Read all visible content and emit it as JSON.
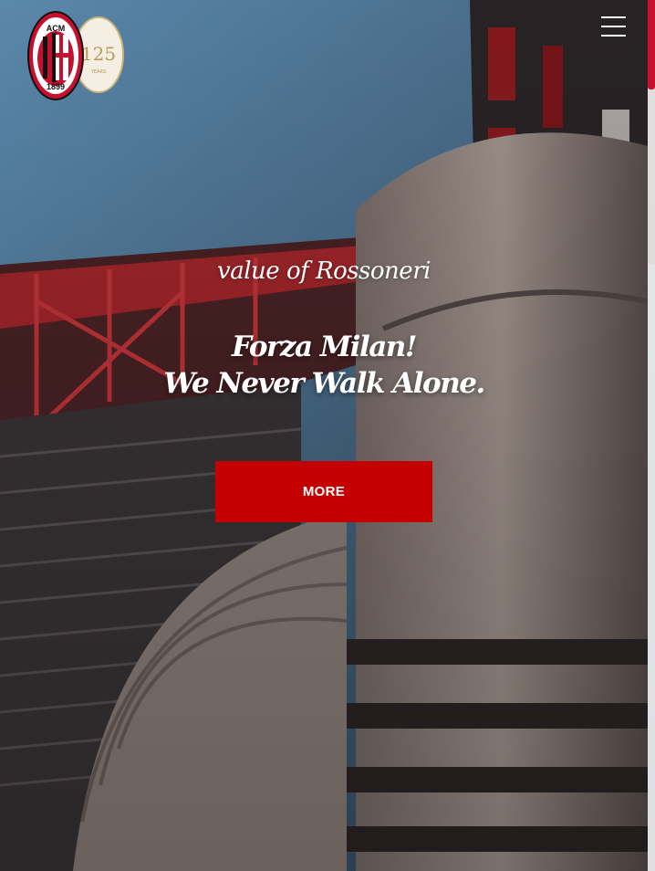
{
  "header": {
    "logo": {
      "crest_text_top": "ACM",
      "crest_text_bottom": "1899",
      "badge_number": "125",
      "badge_text": "YEARS"
    },
    "menu_icon": "hamburger-menu-icon"
  },
  "hero": {
    "subtitle": "value of Rossoneri",
    "tagline_line1": "Forza Milan!",
    "tagline_line2": "We Never Walk Alone.",
    "cta_label": "MORE"
  },
  "colors": {
    "accent": "#c50000",
    "scrollbar_thumb": "#c8102e",
    "text": "#ffffff"
  }
}
